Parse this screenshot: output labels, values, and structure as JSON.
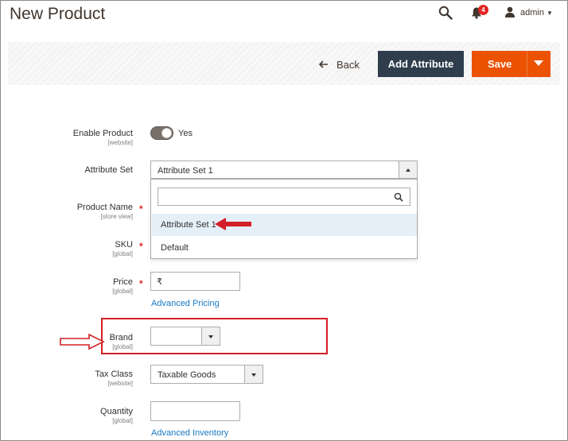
{
  "header": {
    "title": "New Product",
    "notification_count": "4",
    "user_name": "admin"
  },
  "actions": {
    "back_label": "Back",
    "add_attribute_label": "Add Attribute",
    "save_label": "Save"
  },
  "form": {
    "enable_product": {
      "label": "Enable Product",
      "scope": "[website]",
      "toggle_value": "Yes",
      "enabled": true
    },
    "attribute_set": {
      "label": "Attribute Set",
      "value": "Attribute Set 1",
      "search_placeholder": "",
      "options": [
        "Attribute Set 1",
        "Default"
      ]
    },
    "product_name": {
      "label": "Product Name",
      "scope": "[store view]",
      "value": ""
    },
    "sku": {
      "label": "SKU",
      "scope": "[global]",
      "value": ""
    },
    "price": {
      "label": "Price",
      "scope": "[global]",
      "currency_symbol": "₹",
      "value": "",
      "link": "Advanced Pricing"
    },
    "brand": {
      "label": "Brand",
      "scope": "[global]",
      "value": ""
    },
    "tax_class": {
      "label": "Tax Class",
      "scope": "[website]",
      "value": "Taxable Goods"
    },
    "quantity": {
      "label": "Quantity",
      "scope": "[global]",
      "value": "",
      "link": "Advanced Inventory"
    }
  },
  "colors": {
    "primary_button": "#2f3d4d",
    "save_button": "#eb5202",
    "link": "#1979c3",
    "required": "#e22626",
    "annotation": "#d41e25",
    "option_highlight": "#e5eff7"
  },
  "icons": [
    "search-icon",
    "bell-icon",
    "user-icon",
    "back-arrow-icon",
    "chevron-up-icon",
    "chevron-down-icon"
  ]
}
